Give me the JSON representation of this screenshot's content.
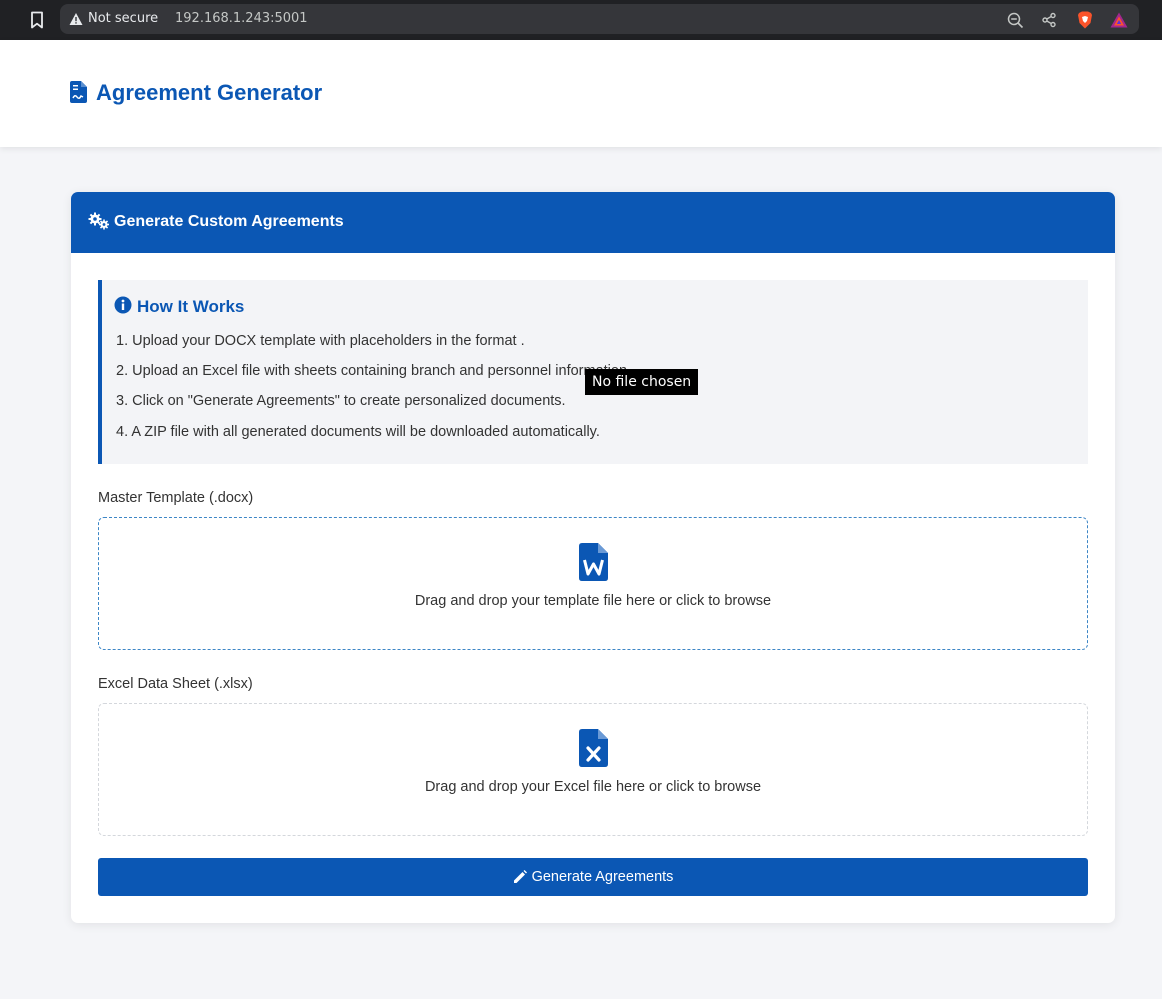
{
  "browser": {
    "security_label": "Not secure",
    "url": "192.168.1.243:5001"
  },
  "app": {
    "title": "Agreement Generator"
  },
  "card": {
    "title": "Generate Custom Agreements"
  },
  "info": {
    "title": "How It Works",
    "steps": [
      "1. Upload your DOCX template with placeholders in the format .",
      "2. Upload an Excel file with sheets containing branch and personnel information.",
      "3. Click on \"Generate Agreements\" to create personalized documents.",
      "4. A ZIP file with all generated documents will be downloaded automatically."
    ]
  },
  "template_upload": {
    "label": "Master Template (.docx)",
    "prompt": "Drag and drop your template file here or click to browse",
    "tooltip": "No file chosen"
  },
  "excel_upload": {
    "label": "Excel Data Sheet (.xlsx)",
    "prompt": "Drag and drop your Excel file here or click to browse"
  },
  "generate_button": {
    "label": "Generate Agreements"
  },
  "colors": {
    "primary": "#0b57b4",
    "page_background": "#f4f5f8",
    "info_background": "#f3f4f7"
  },
  "icons": {
    "bookmark": "bookmark-icon",
    "security": "warning-triangle-icon",
    "zoom": "zoom-out-icon",
    "share": "share-icon",
    "brave": "brave-shield-icon",
    "rewards": "brave-rewards-icon",
    "logo": "file-contract-icon",
    "card_header": "cogs-icon",
    "info": "info-circle-icon",
    "template": "file-word-icon",
    "excel": "file-excel-icon",
    "generate": "pencil-icon"
  }
}
